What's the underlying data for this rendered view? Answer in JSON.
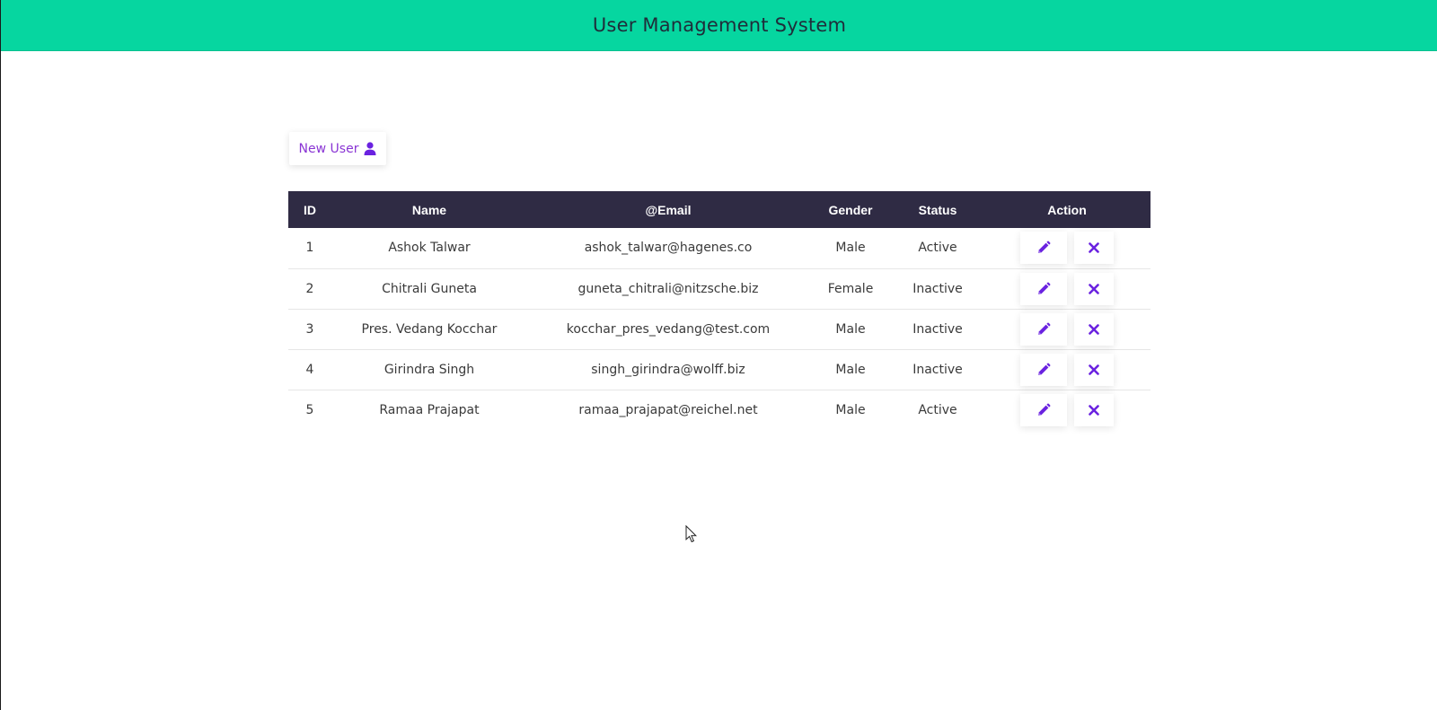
{
  "header": {
    "title": "User Management System"
  },
  "toolbar": {
    "new_user_label": "New User",
    "new_user_icon": "user-icon"
  },
  "colors": {
    "header_bg": "#06d6a0",
    "table_header_bg": "#2f2b44",
    "accent": "#8a35d4",
    "action_icon": "#6a22e0"
  },
  "table": {
    "columns": [
      "ID",
      "Name",
      "@Email",
      "Gender",
      "Status",
      "Action"
    ],
    "rows": [
      {
        "id": "1",
        "name": "Ashok Talwar",
        "email": "ashok_talwar@hagenes.co",
        "gender": "Male",
        "status": "Active"
      },
      {
        "id": "2",
        "name": "Chitrali Guneta",
        "email": "guneta_chitrali@nitzsche.biz",
        "gender": "Female",
        "status": "Inactive"
      },
      {
        "id": "3",
        "name": "Pres. Vedang Kocchar",
        "email": "kocchar_pres_vedang@test.com",
        "gender": "Male",
        "status": "Inactive"
      },
      {
        "id": "4",
        "name": "Girindra Singh",
        "email": "singh_girindra@wolff.biz",
        "gender": "Male",
        "status": "Inactive"
      },
      {
        "id": "5",
        "name": "Ramaa Prajapat",
        "email": "ramaa_prajapat@reichel.net",
        "gender": "Male",
        "status": "Active"
      }
    ],
    "row_actions": {
      "edit_icon": "pencil-icon",
      "delete_icon": "close-icon"
    }
  }
}
